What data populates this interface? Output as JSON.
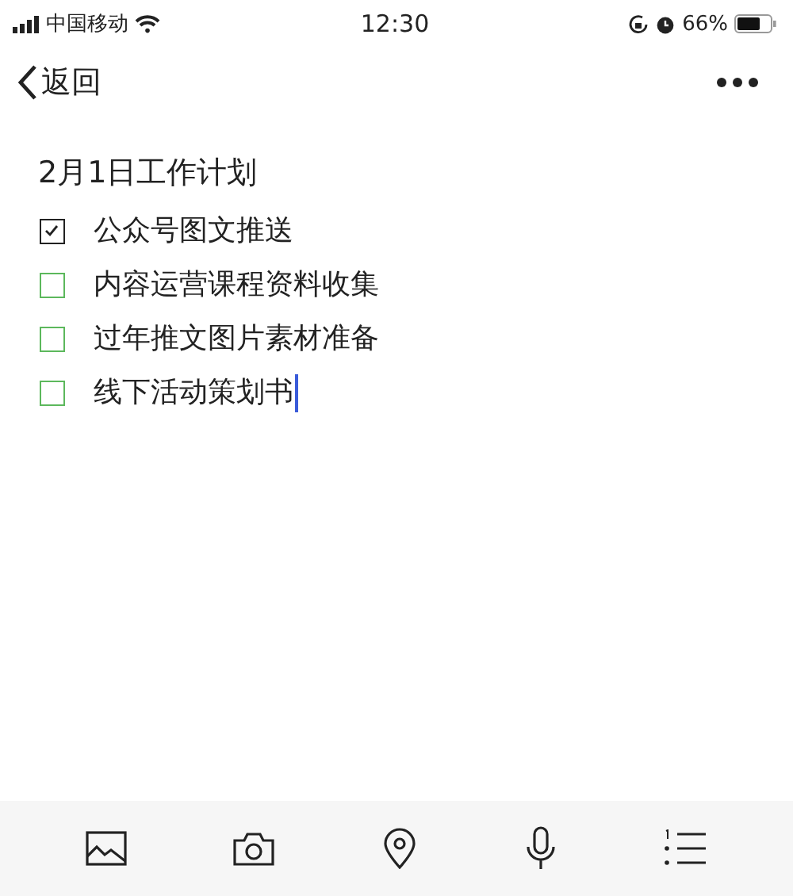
{
  "status_bar": {
    "carrier": "中国移动",
    "time": "12:30",
    "battery": "66%"
  },
  "nav": {
    "back": "返回"
  },
  "note": {
    "title": "2月1日工作计划",
    "items": [
      {
        "text": "公众号图文推送",
        "checked": true,
        "cursor": false
      },
      {
        "text": "内容运营课程资料收集",
        "checked": false,
        "cursor": false
      },
      {
        "text": "过年推文图片素材准备",
        "checked": false,
        "cursor": false
      },
      {
        "text": "线下活动策划书",
        "checked": false,
        "cursor": true
      }
    ]
  },
  "toolbar": {
    "tools": [
      {
        "kind": "image"
      },
      {
        "kind": "camera"
      },
      {
        "kind": "location"
      },
      {
        "kind": "microphone"
      },
      {
        "kind": "list"
      }
    ]
  }
}
